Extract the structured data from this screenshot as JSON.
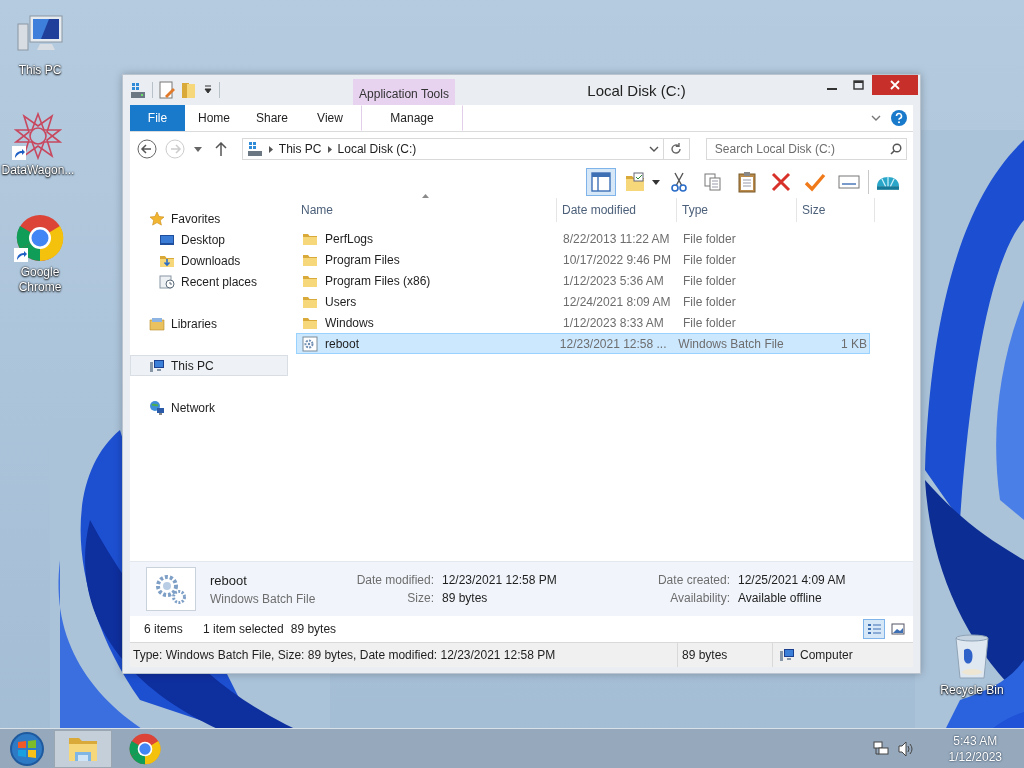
{
  "desktop_icons": [
    {
      "label": "This PC",
      "kind": "pc",
      "shortcut": false
    },
    {
      "label": "DataWagon...",
      "kind": "star",
      "shortcut": true
    },
    {
      "label": "Google Chrome",
      "kind": "chrome",
      "shortcut": true
    },
    {
      "label": "Recycle Bin",
      "kind": "bin",
      "shortcut": false
    }
  ],
  "window": {
    "title": "Local Disk (C:)",
    "context_group": "Application Tools",
    "ribbon_tabs": [
      {
        "label": "File",
        "kind": "file",
        "selected": false
      },
      {
        "label": "Home",
        "kind": "tab",
        "selected": false
      },
      {
        "label": "Share",
        "kind": "tab",
        "selected": false
      },
      {
        "label": "View",
        "kind": "tab",
        "selected": false
      },
      {
        "label": "Manage",
        "kind": "context",
        "selected": false
      }
    ],
    "address": [
      "This PC",
      "Local Disk (C:)"
    ],
    "search": {
      "placeholder": "Search Local Disk (C:)"
    },
    "toolbar": [
      {
        "kind": "pane",
        "pressed": true
      },
      {
        "kind": "folder",
        "pressed": false
      },
      {
        "kind": "cut",
        "pressed": false
      },
      {
        "kind": "copy",
        "pressed": false
      },
      {
        "kind": "paste",
        "pressed": false
      },
      {
        "kind": "delete",
        "pressed": false
      },
      {
        "kind": "check",
        "pressed": false
      },
      {
        "kind": "card",
        "pressed": false
      },
      {
        "kind": "shell",
        "pressed": false
      }
    ],
    "navigation": [
      {
        "label": "Favorites",
        "kind": "star",
        "selected": false,
        "children": [
          {
            "label": "Desktop",
            "kind": "desktop",
            "selected": false
          },
          {
            "label": "Downloads",
            "kind": "downloads",
            "selected": false
          },
          {
            "label": "Recent places",
            "kind": "recent",
            "selected": false
          }
        ]
      },
      {
        "label": "Libraries",
        "kind": "library",
        "selected": false
      },
      {
        "label": "This PC",
        "kind": "pc",
        "selected": true
      },
      {
        "label": "Network",
        "kind": "network",
        "selected": false
      }
    ],
    "columns": [
      "Name",
      "Date modified",
      "Type",
      "Size"
    ],
    "rows": [
      {
        "name": "PerfLogs",
        "date": "8/22/2013 11:22 AM",
        "type": "File folder",
        "size": "",
        "kind": "folder",
        "selected": false
      },
      {
        "name": "Program Files",
        "date": "10/17/2022 9:46 PM",
        "type": "File folder",
        "size": "",
        "kind": "folder",
        "selected": false
      },
      {
        "name": "Program Files (x86)",
        "date": "1/12/2023 5:36 AM",
        "type": "File folder",
        "size": "",
        "kind": "folder",
        "selected": false
      },
      {
        "name": "Users",
        "date": "12/24/2021 8:09 AM",
        "type": "File folder",
        "size": "",
        "kind": "folder",
        "selected": false
      },
      {
        "name": "Windows",
        "date": "1/12/2023 8:33 AM",
        "type": "File folder",
        "size": "",
        "kind": "folder",
        "selected": false
      },
      {
        "name": "reboot",
        "date": "12/23/2021 12:58 ...",
        "type": "Windows Batch File",
        "size": "1 KB",
        "kind": "batch",
        "selected": true
      }
    ],
    "details": {
      "name": "reboot",
      "type": "Windows Batch File",
      "fields": [
        {
          "label": "Date modified:",
          "value": "12/23/2021 12:58 PM"
        },
        {
          "label": "Date created:",
          "value": "12/25/2021 4:09 AM"
        },
        {
          "label": "Size:",
          "value": "89 bytes"
        },
        {
          "label": "Availability:",
          "value": "Available offline"
        }
      ]
    },
    "status": {
      "count": "6 items",
      "selection": "1 item selected",
      "selection_size": "89 bytes"
    },
    "views": [
      {
        "kind": "details",
        "selected": true
      },
      {
        "kind": "large",
        "selected": false
      }
    ],
    "status_bar": {
      "description": "Type: Windows Batch File, Size: 89 bytes, Date modified: 12/23/2021 12:58 PM",
      "size": "89 bytes",
      "zone": "Computer"
    }
  },
  "taskbar": {
    "apps": [
      {
        "kind": "explorer",
        "selected": true
      },
      {
        "kind": "chrome",
        "selected": false
      }
    ],
    "time": "5:43 AM",
    "date": "1/12/2023"
  }
}
